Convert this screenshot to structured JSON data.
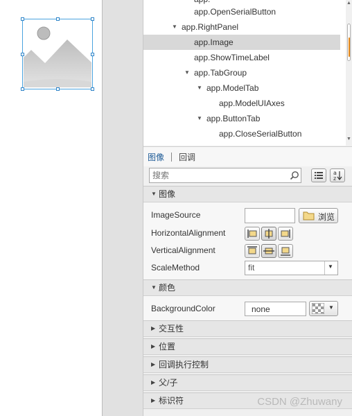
{
  "canvas": {
    "image_component": {
      "icon": "image-placeholder-icon"
    }
  },
  "tree": {
    "items": [
      {
        "label": "app.OpenSerialButton",
        "indent": 2,
        "expandable": false,
        "selected": false
      },
      {
        "label": "app.RightPanel",
        "indent": 1,
        "expandable": true,
        "selected": false
      },
      {
        "label": "app.Image",
        "indent": 2,
        "expandable": false,
        "selected": true
      },
      {
        "label": "app.ShowTimeLabel",
        "indent": 2,
        "expandable": false,
        "selected": false
      },
      {
        "label": "app.TabGroup",
        "indent": 2,
        "expandable": true,
        "selected": false
      },
      {
        "label": "app.ModelTab",
        "indent": 3,
        "expandable": true,
        "selected": false
      },
      {
        "label": "app.ModelUIAxes",
        "indent": 4,
        "expandable": false,
        "selected": false
      },
      {
        "label": "app.ButtonTab",
        "indent": 3,
        "expandable": true,
        "selected": false
      },
      {
        "label": "app.CloseSerialButton",
        "indent": 4,
        "expandable": false,
        "selected": false
      }
    ]
  },
  "inspector": {
    "tabs": [
      {
        "label": "图像",
        "active": true
      },
      {
        "label": "回调",
        "active": false
      }
    ],
    "search": {
      "placeholder": "搜索"
    },
    "sections": {
      "image": "图像",
      "color": "颜色",
      "interactivity": "交互性",
      "position": "位置",
      "callback_control": "回调执行控制",
      "parent_child": "父/子",
      "identifiers": "标识符"
    },
    "props": {
      "image_source": {
        "label": "ImageSource",
        "value": "",
        "browse_label": "浏览"
      },
      "horizontal_alignment": {
        "label": "HorizontalAlignment",
        "selected": "center"
      },
      "vertical_alignment": {
        "label": "VerticalAlignment",
        "selected": "center"
      },
      "scale_method": {
        "label": "ScaleMethod",
        "value": "fit"
      },
      "background_color": {
        "label": "BackgroundColor",
        "value": "none"
      }
    }
  },
  "watermark": "CSDN @Zhuwany",
  "colors": {
    "selection": "#d8d8d8",
    "active_tab": "#1c5a96",
    "scroll_accent": "#e88a1a",
    "selection_handle": "#2f84c8"
  }
}
